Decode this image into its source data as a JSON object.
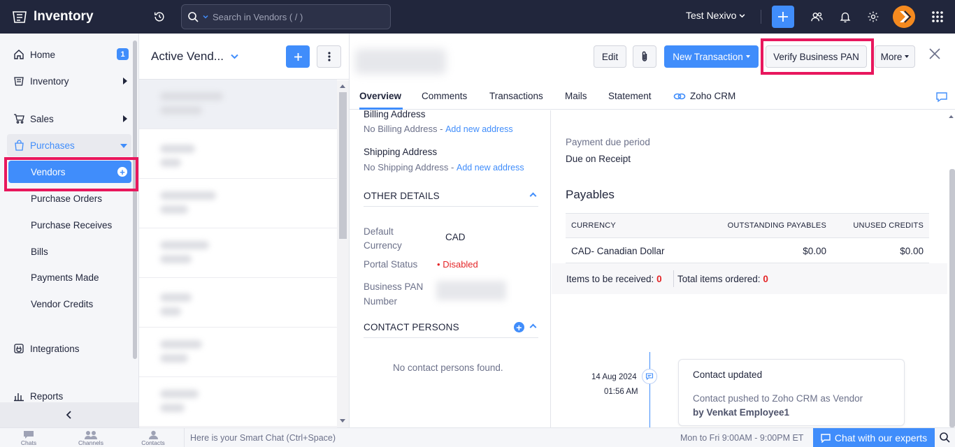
{
  "app": {
    "title": "Inventory"
  },
  "topbar": {
    "search_placeholder": "Search in Vendors ( / )",
    "org_name": "Test Nexivo",
    "icons": [
      "recent-activity-icon",
      "search-icon",
      "plus-icon",
      "users-icon",
      "bell-icon",
      "gear-icon",
      "apps-grid-icon"
    ],
    "accent": "#408dfb"
  },
  "sidebar": {
    "home": {
      "label": "Home",
      "badge": "1"
    },
    "inventory": "Inventory",
    "sales": "Sales",
    "purchases": "Purchases",
    "sub": {
      "vendors": "Vendors",
      "purchase_orders": "Purchase Orders",
      "purchase_receives": "Purchase Receives",
      "bills": "Bills",
      "payments_made": "Payments Made",
      "vendor_credits": "Vendor Credits"
    },
    "integrations": "Integrations",
    "reports": "Reports"
  },
  "list": {
    "title": "Active Vend...",
    "add_icon": "plus-icon",
    "more_icon": "kebab-icon"
  },
  "detail": {
    "buttons": {
      "edit": "Edit",
      "new_transaction": "New Transaction",
      "verify_pan": "Verify Business PAN",
      "more": "More"
    },
    "tabs": [
      "Overview",
      "Comments",
      "Transactions",
      "Mails",
      "Statement",
      "Zoho CRM"
    ],
    "billing": {
      "label": "Billing Address",
      "value": "No Billing Address -",
      "link": "Add new address"
    },
    "shipping": {
      "label": "Shipping Address",
      "value": "No Shipping Address -",
      "link": "Add new address"
    },
    "other_details": {
      "title": "OTHER DETAILS",
      "currency_label_1": "Default",
      "currency_label_2": "Currency",
      "currency_value": "CAD",
      "portal_label": "Portal Status",
      "portal_value": "Disabled",
      "pan_label_1": "Business PAN",
      "pan_label_2": "Number"
    },
    "contact_persons": {
      "title": "CONTACT PERSONS",
      "empty": "No contact persons found."
    },
    "payment": {
      "label": "Payment due period",
      "value": "Due on Receipt"
    },
    "payables": {
      "title": "Payables",
      "headers": [
        "CURRENCY",
        "OUTSTANDING PAYABLES",
        "UNUSED CREDITS"
      ],
      "rows": [
        {
          "currency": "CAD- Canadian Dollar",
          "outstanding": "$0.00",
          "unused": "$0.00"
        }
      ]
    },
    "items": {
      "to_receive_label": "Items to be received:",
      "to_receive_value": "0",
      "ordered_label": "Total items ordered:",
      "ordered_value": "0"
    },
    "timeline": {
      "date": "14 Aug 2024",
      "time": "01:56 AM",
      "title": "Contact updated",
      "body": "Contact pushed to Zoho CRM as Vendor",
      "by": "by Venkat Employee1"
    }
  },
  "bottombar": {
    "chats": "Chats",
    "channels": "Channels",
    "contacts": "Contacts",
    "smart_chat": "Here is your Smart Chat (Ctrl+Space)",
    "hours": "Mon to Fri 9:00AM - 9:00PM ET",
    "chat_experts": "Chat with our experts"
  }
}
